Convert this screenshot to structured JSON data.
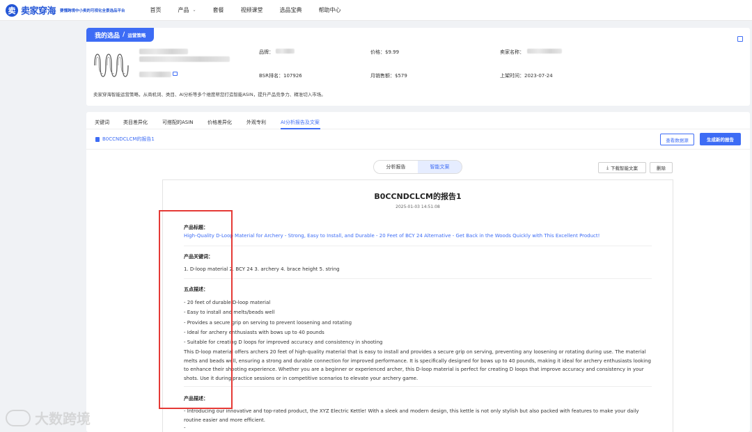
{
  "brand": {
    "logo_char": "卖",
    "name": "卖家穿海",
    "slogan": "要懂跨境中小卖的可视化全景选品平台"
  },
  "nav": {
    "items": [
      {
        "label": "首页"
      },
      {
        "label": "产品"
      },
      {
        "label": "套餐"
      },
      {
        "label": "视频课堂"
      },
      {
        "label": "选品宝典"
      },
      {
        "label": "帮助中心"
      }
    ],
    "caret": "⌄"
  },
  "product": {
    "tag": "我的选品",
    "tag_sep": "/",
    "tag_sub": "运营策略",
    "brand_label": "品牌：",
    "price_label": "价格：",
    "price": "$9.99",
    "seller_label": "卖家名称：",
    "bsr_label": "BSR排名：",
    "bsr": "107926",
    "monthly_sales_label": "月销售额：",
    "monthly_sales": "$579",
    "listed_label": "上架时间：",
    "listed": "2023-07-24",
    "description": "卖家穿海智能运营策略，从商机词、类目、AI分析等多个维度帮您打造智能ASIN，提升产品竞争力、精准切入市场。"
  },
  "tabs": [
    {
      "label": "关键词"
    },
    {
      "label": "类目差异化"
    },
    {
      "label": "可搭配的ASIN"
    },
    {
      "label": "价格差异化"
    },
    {
      "label": "外观专利"
    },
    {
      "label": "AI分析报告及文案"
    }
  ],
  "toolbar": {
    "report_name": "B0CCNDCLCM的报告1",
    "view_source": "查看数据源",
    "generate": "生成新的报告"
  },
  "segment": {
    "analysis": "分析报告",
    "copy": "智能文案"
  },
  "actions": {
    "download": "下载智能文案",
    "download_icon": "⤓",
    "delete": "删除"
  },
  "report": {
    "title": "B0CCNDCLCM的报告1",
    "time": "2025-01-03 14:51:08",
    "title_head": "产品标题：",
    "title_text": "High-Quality D-Loop Material for Archery - Strong, Easy to Install, and Durable - 20 Feet of BCY 24 Alternative - Get Back in the Woods Quickly with This Excellent Product!",
    "keywords_head": "产品关键词：",
    "keywords_text": "1. D-loop material 2. BCY 24 3. archery 4. brace height 5. string",
    "bullets_head": "五点描述：",
    "bullets": [
      "- 20 feet of durable D-loop material",
      "- Easy to install and melts/beads well",
      "- Provides a secure grip on serving to prevent loosening and rotating",
      "- Ideal for archery enthusiasts with bows up to 40 pounds",
      "- Suitable for creating D loops for improved accuracy and consistency in shooting"
    ],
    "bullets_para": "This D-loop material offers archers 20 feet of high-quality material that is easy to install and provides a secure grip on serving, preventing any loosening or rotating during use. The material melts and beads well, ensuring a strong and durable connection for improved performance. It is specifically designed for bows up to 40 pounds, making it ideal for archery enthusiasts looking to enhance their shooting experience. Whether you are a beginner or experienced archer, this D-loop material is perfect for creating D loops that improve accuracy and consistency in your shots. Use it during practice sessions or in competitive scenarios to elevate your archery game.",
    "desc_head": "产品描述：",
    "desc_text": "- Introducing our innovative and top-rated product, the XYZ Electric Kettle! With a sleek and modern design, this kettle is not only stylish but also packed with features to make your daily routine easier and more efficient.",
    "desc_tail": "-"
  },
  "watermark": "大数跨境",
  "colors": {
    "accent": "#3d6cf5",
    "highlight": "#e53935"
  }
}
